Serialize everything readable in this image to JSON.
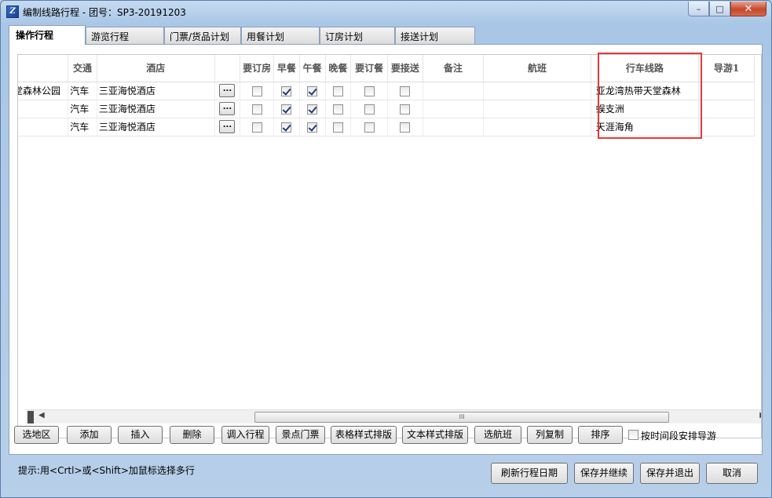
{
  "window": {
    "title": "编制线路行程 - 团号：SP3-20191203",
    "icon": "app-logo-icon"
  },
  "tabs": [
    {
      "label": "操作行程"
    },
    {
      "label": "游览行程"
    },
    {
      "label": "门票/货品计划"
    },
    {
      "label": "用餐计划"
    },
    {
      "label": "订房计划"
    },
    {
      "label": "接送计划"
    }
  ],
  "grid": {
    "columns": [
      "",
      "交通",
      "酒店",
      "",
      "要订房",
      "早餐",
      "午餐",
      "晚餐",
      "要订餐",
      "要接送",
      "备注",
      "航班",
      "行车线路",
      "导游1"
    ],
    "rows": [
      {
        "scenic": "堂森林公园",
        "transport": "汽车",
        "hotel": "三亚海悦酒店",
        "ellipsis": "...",
        "book_room": false,
        "breakfast": true,
        "lunch": true,
        "dinner": false,
        "book_meal": false,
        "transfer": false,
        "remark": "",
        "flight": "",
        "route": "亚龙湾热带天堂森林",
        "guide": ""
      },
      {
        "scenic": "",
        "transport": "汽车",
        "hotel": "三亚海悦酒店",
        "ellipsis": "...",
        "book_room": false,
        "breakfast": true,
        "lunch": true,
        "dinner": false,
        "book_meal": false,
        "transfer": false,
        "remark": "",
        "flight": "",
        "route": "蜈支洲",
        "guide": ""
      },
      {
        "scenic": "“",
        "transport": "汽车",
        "hotel": "三亚海悦酒店",
        "ellipsis": "...",
        "book_room": false,
        "breakfast": true,
        "lunch": true,
        "dinner": false,
        "book_meal": false,
        "transfer": false,
        "remark": "",
        "flight": "",
        "route": "天涯海角",
        "guide": ""
      }
    ],
    "highlight_color": "#e33b3b",
    "scroll_grip": "III"
  },
  "buttons": {
    "select_area": "选地区",
    "add": "添加",
    "insert": "插入",
    "delete": "删除",
    "import_itinerary": "调入行程",
    "scenic_tickets": "景点门票",
    "table_layout": "表格样式排版",
    "text_layout": "文本样式排版",
    "select_flight": "选航班",
    "copy_column": "列复制",
    "sort": "排序",
    "arrange_guide_label": "按时间段安排导游"
  },
  "footer": {
    "hint": "提示:用<Crtl>或<Shift>加鼠标选择多行",
    "refresh_dates": "刷新行程日期",
    "save_continue": "保存并继续",
    "save_exit": "保存并退出",
    "cancel": "取消"
  },
  "window_controls": {
    "minimize": "–",
    "maximize": "□",
    "close": "✕"
  }
}
